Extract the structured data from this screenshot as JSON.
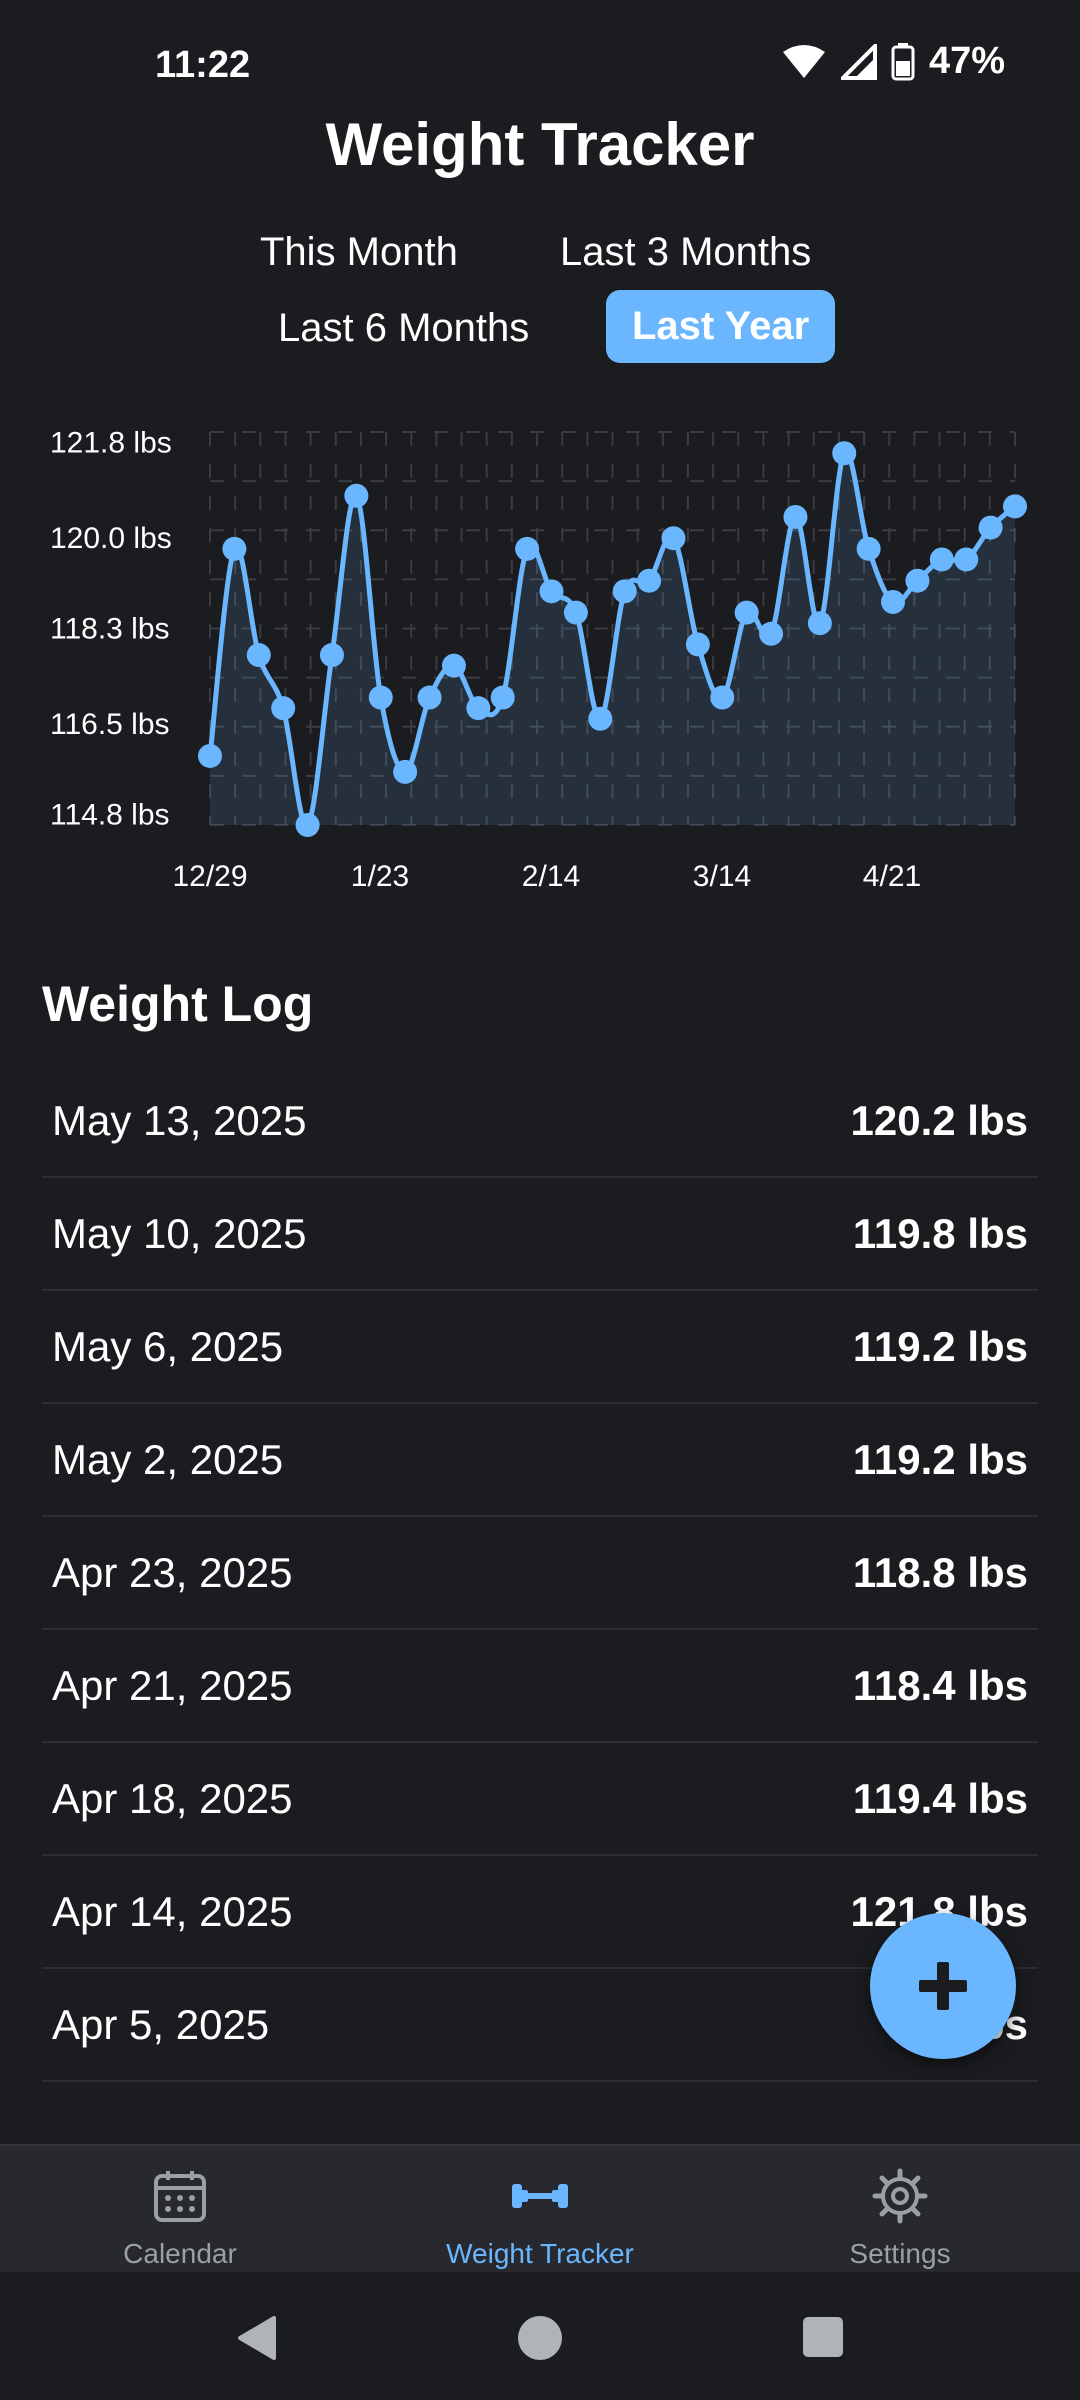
{
  "status": {
    "time": "11:22",
    "battery": "47%"
  },
  "title": "Weight Tracker",
  "ranges": [
    "This Month",
    "Last 3 Months",
    "Last 6 Months",
    "Last Year"
  ],
  "active_range": "Last Year",
  "chart_data": {
    "type": "line",
    "y_tick_labels": [
      "121.8 lbs",
      "120.0 lbs",
      "118.3 lbs",
      "116.5 lbs",
      "114.8 lbs"
    ],
    "y_ticks": [
      121.8,
      120.0,
      118.3,
      116.5,
      114.8
    ],
    "x_tick_labels": [
      "12/29",
      "1/23",
      "2/14",
      "3/14",
      "4/21"
    ],
    "ylim": [
      114.6,
      122.0
    ],
    "color": "#6ab7ff",
    "values": [
      115.9,
      119.8,
      117.8,
      116.8,
      114.6,
      117.8,
      120.8,
      117.0,
      115.6,
      117.0,
      117.6,
      116.8,
      117.0,
      119.8,
      119.0,
      118.6,
      116.6,
      119.0,
      119.2,
      120.0,
      118.0,
      117.0,
      118.6,
      118.2,
      120.4,
      118.4,
      121.6,
      119.8,
      118.8,
      119.2,
      119.6,
      119.6,
      120.2,
      120.6
    ]
  },
  "log_title": "Weight Log",
  "log": [
    {
      "date": "May 13, 2025",
      "weight": "120.2 lbs"
    },
    {
      "date": "May 10, 2025",
      "weight": "119.8 lbs"
    },
    {
      "date": "May 6, 2025",
      "weight": "119.2 lbs"
    },
    {
      "date": "May 2, 2025",
      "weight": "119.2 lbs"
    },
    {
      "date": "Apr 23, 2025",
      "weight": "118.8 lbs"
    },
    {
      "date": "Apr 21, 2025",
      "weight": "118.4 lbs"
    },
    {
      "date": "Apr 18, 2025",
      "weight": "119.4 lbs"
    },
    {
      "date": "Apr 14, 2025",
      "weight": "121.8 lbs"
    },
    {
      "date": "Apr 5, 2025",
      "weight": "lbs"
    }
  ],
  "nav": {
    "calendar": "Calendar",
    "weight": "Weight Tracker",
    "settings": "Settings"
  },
  "colors": {
    "accent": "#6ab7ff",
    "background": "#1b1c20",
    "nav_background": "#27292e"
  }
}
